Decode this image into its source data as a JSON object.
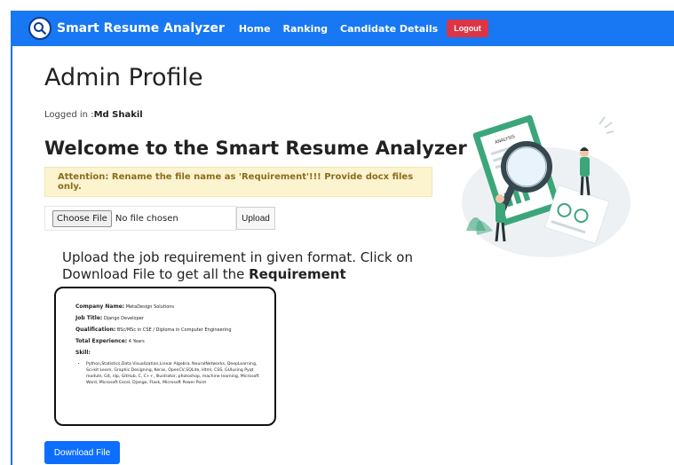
{
  "navbar": {
    "brand": "Smart Resume Analyzer",
    "links": [
      "Home",
      "Ranking",
      "Candidate Details"
    ],
    "logout": "Logout"
  },
  "page": {
    "title": "Admin Profile",
    "logged_in_prefix": "Logged in :",
    "logged_in_user": "Md Shakil",
    "welcome": "Welcome to the Smart Resume Analyzer",
    "alert": "Attention: Rename the file name as 'Requirement'!!! Provide docx files only."
  },
  "upload": {
    "choose_label": "Choose File",
    "no_file_text": "No file chosen",
    "upload_label": "Upload"
  },
  "instructions": {
    "text": "Upload the job requirement in given format. Click on Download File to get all the ",
    "bold": "Requirement"
  },
  "sample": {
    "company_label": "Company Name:",
    "company_value": "MetaDesign Solutions",
    "job_label": "Job Title:",
    "job_value": "Django Developer",
    "qual_label": "Qualification:",
    "qual_value": "BSc/MSc in CSE / Diploma in Computer Engineering",
    "exp_label": "Total Experience:",
    "exp_value": "4 Years",
    "skill_label": "Skill:",
    "skills": "Python,Statistics,Data Visualization,Linear Algebra, NeuralNetworks, DeepLearning, Sci-kit Learn, Graphic Designing, Keras, OpenCV,SQLite, Html, CSS, GUIusing Pyqt module, Git, nlp, GitHub, C, C++, Illustrator, photoshop, machine learning, Microsoft Word, Microsoft Excel, Django, Flask, Microsoft Power Point"
  },
  "download_label": "Download File",
  "illustration": {
    "label": "ANALYSIS"
  },
  "colors": {
    "navbar": "#1877f2",
    "logout": "#dc3545",
    "alert_bg": "#fcf3cf",
    "download": "#0d6efd",
    "illustration_green": "#3ba67a"
  }
}
